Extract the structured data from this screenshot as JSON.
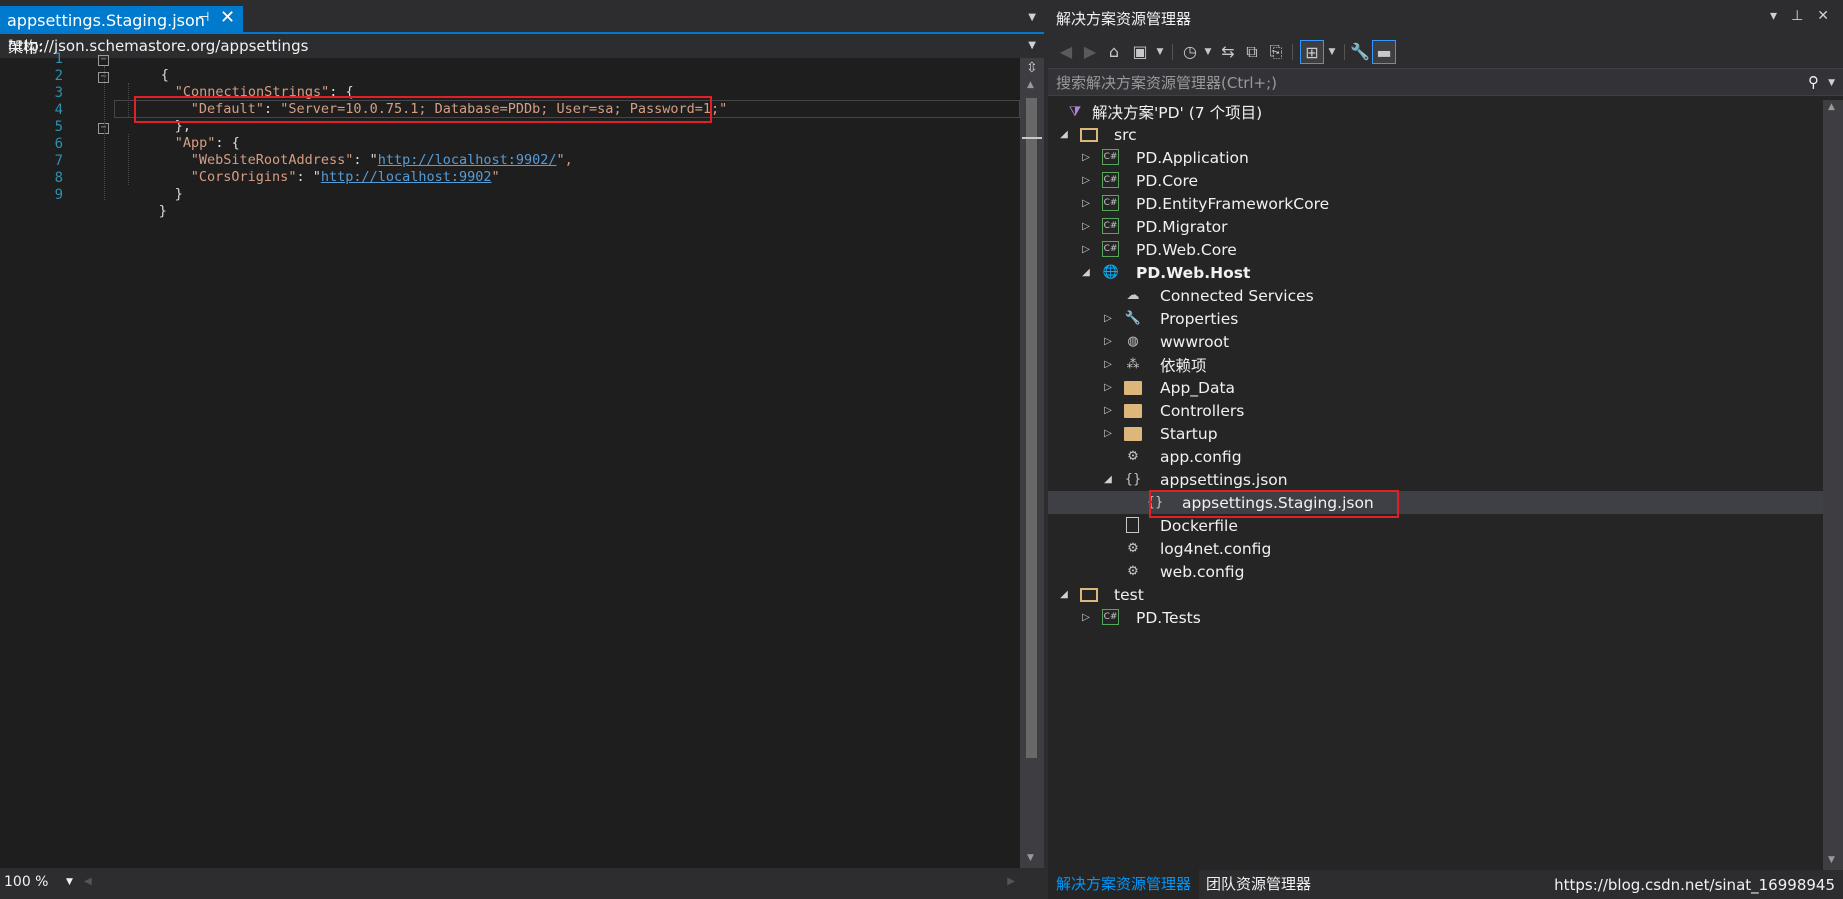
{
  "editor": {
    "tab_title": "appsettings.Staging.json",
    "tab_pin_glyph": "⊣",
    "tab_close_glyph": "✕",
    "schema_label": "架构:",
    "schema_url": "http://json.schemastore.org/appsettings",
    "zoom": "100 %",
    "line_numbers": [
      "1",
      "2",
      "3",
      "4",
      "5",
      "6",
      "7",
      "8",
      "9"
    ],
    "code": {
      "l1_open": "{",
      "l2_key": "\"ConnectionStrings\"",
      "l2_rest": ": {",
      "l3_key": "\"Default\"",
      "l3_colon": ": ",
      "l3_value": "\"Server=10.0.75.1; Database=PDDb; User=sa; Password=1;\"",
      "l4_close": "},",
      "l5_key": "\"App\"",
      "l5_rest": ": {",
      "l6_key": "\"WebSiteRootAddress\"",
      "l6_colon": ": \"",
      "l6_link": "http://localhost:9902/",
      "l6_end": "\",",
      "l7_key": "\"CorsOrigins\"",
      "l7_colon": ": \"",
      "l7_link": "http://localhost:9902",
      "l7_end": "\"",
      "l8_close": "}",
      "l9_close": "}"
    }
  },
  "solution_explorer": {
    "title": "解决方案资源管理器",
    "search_placeholder": "搜索解决方案资源管理器(Ctrl+;)",
    "tree": {
      "solution": "解决方案'PD' (7 个项目)",
      "src": "src",
      "pd_application": "PD.Application",
      "pd_core": "PD.Core",
      "pd_efcore": "PD.EntityFrameworkCore",
      "pd_migrator": "PD.Migrator",
      "pd_web_core": "PD.Web.Core",
      "pd_web_host": "PD.Web.Host",
      "connected_services": "Connected Services",
      "properties": "Properties",
      "wwwroot": "wwwroot",
      "dependencies": "依赖项",
      "app_data": "App_Data",
      "controllers": "Controllers",
      "startup": "Startup",
      "app_config": "app.config",
      "appsettings_json": "appsettings.json",
      "appsettings_staging": "appsettings.Staging.json",
      "dockerfile": "Dockerfile",
      "log4net_config": "log4net.config",
      "web_config": "web.config",
      "test": "test",
      "pd_tests": "PD.Tests"
    },
    "bottom_tabs": {
      "solution_explorer": "解决方案资源管理器",
      "team_explorer": "团队资源管理器"
    },
    "watermark": "https://blog.csdn.net/sinat_16998945"
  },
  "colors": {
    "accent": "#007acc",
    "highlight_box": "#e11f26",
    "string": "#d69d85",
    "link": "#569cd6",
    "line_number": "#2b91af"
  }
}
